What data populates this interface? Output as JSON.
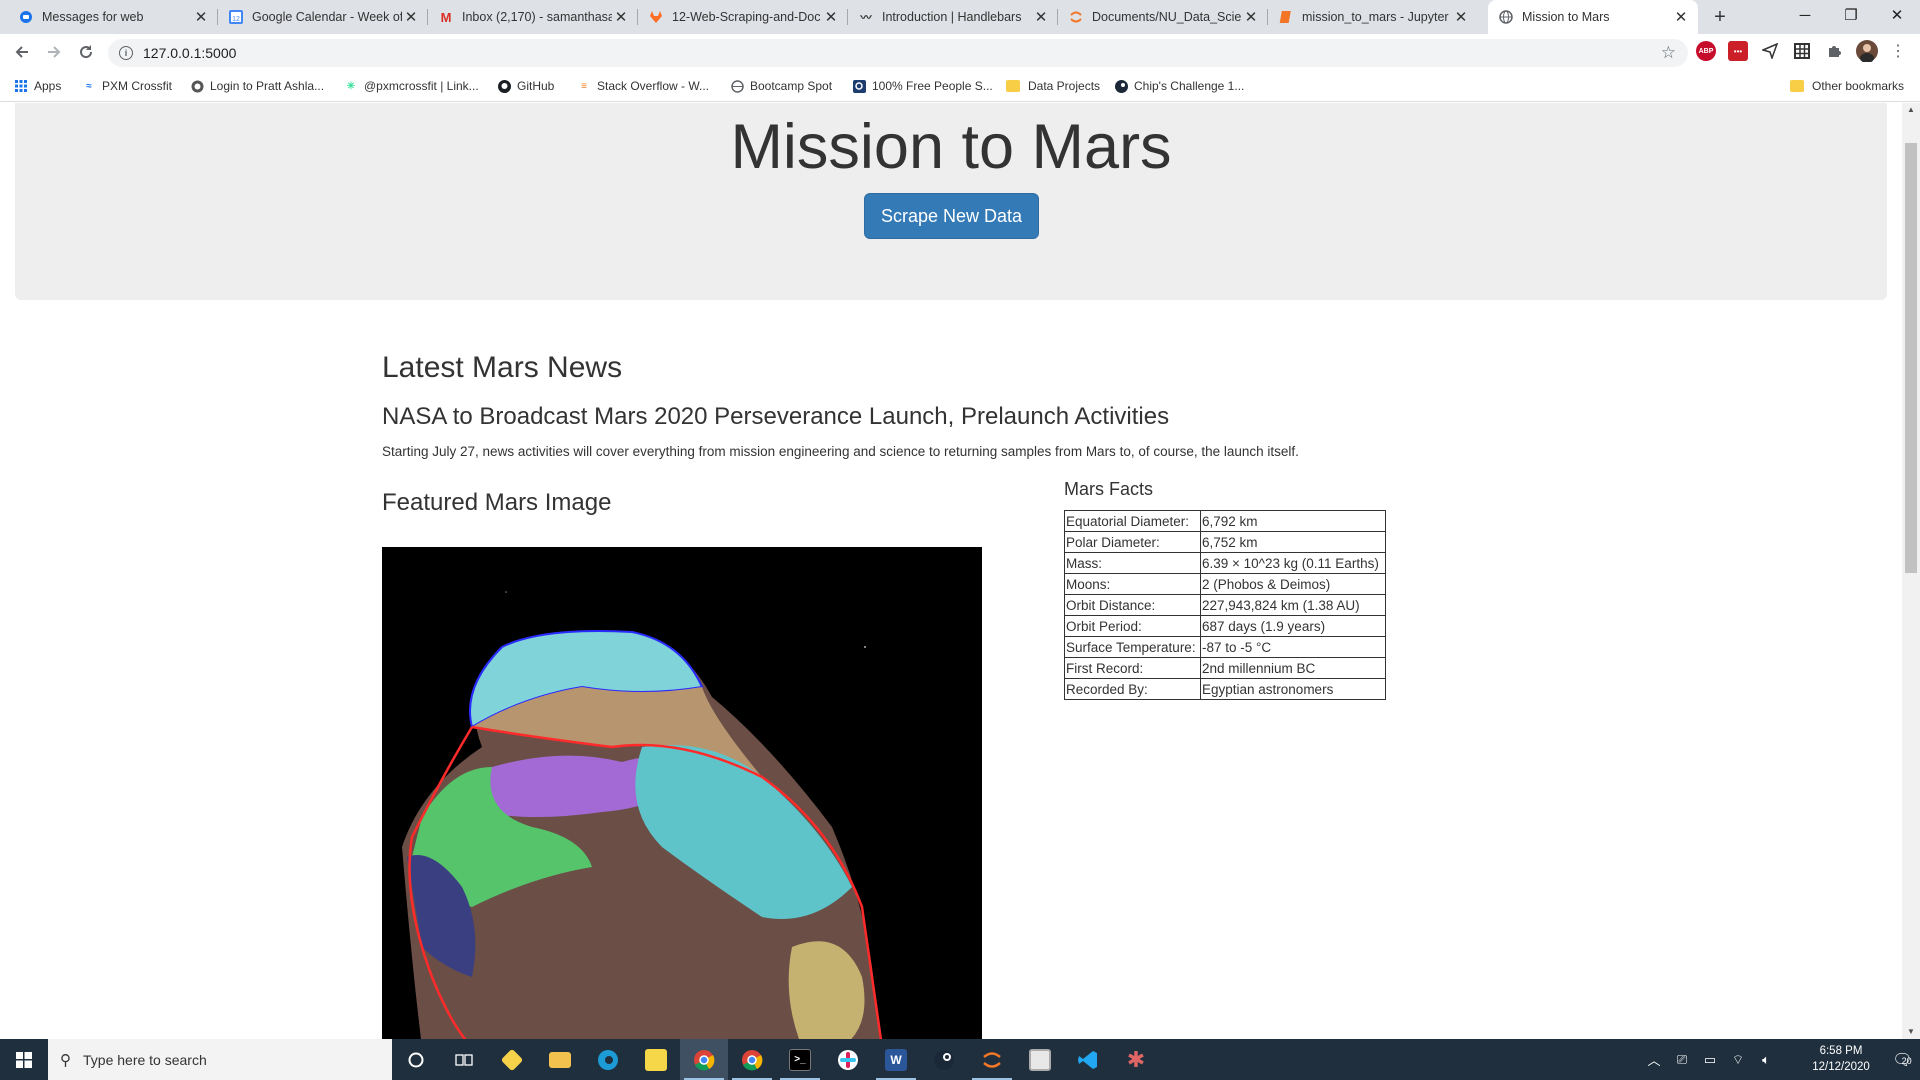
{
  "browser": {
    "tabs": [
      {
        "title": "Messages for web",
        "icon": "messages-icon",
        "color": "#1a73e8"
      },
      {
        "title": "Google Calendar - Week of",
        "icon": "calendar-icon",
        "color": "#4285f4"
      },
      {
        "title": "Inbox (2,170) - samanthasa",
        "icon": "gmail-icon",
        "color": "#d93025"
      },
      {
        "title": "12-Web-Scraping-and-Doc",
        "icon": "gitlab-icon",
        "color": "#fc6d26"
      },
      {
        "title": "Introduction | Handlebars",
        "icon": "handlebars-icon",
        "color": "#333333"
      },
      {
        "title": "Documents/NU_Data_Scien",
        "icon": "jupyter-icon",
        "color": "#f37626"
      },
      {
        "title": "mission_to_mars - Jupyter N",
        "icon": "notebook-icon",
        "color": "#f37626"
      },
      {
        "title": "Mission to Mars",
        "icon": "globe-icon",
        "color": "#5f6368"
      }
    ],
    "url": "127.0.0.1:5000",
    "bookmarks": [
      {
        "label": "Apps",
        "icon": "apps-grid-icon"
      },
      {
        "label": "PXM Crossfit",
        "icon": "pxm-icon"
      },
      {
        "label": "Login to Pratt Ashla...",
        "icon": "pratt-icon"
      },
      {
        "label": "@pxmcrossfit | Link...",
        "icon": "linktree-icon"
      },
      {
        "label": "GitHub",
        "icon": "github-icon"
      },
      {
        "label": "Stack Overflow - W...",
        "icon": "stackoverflow-icon"
      },
      {
        "label": "Bootcamp Spot",
        "icon": "globe-icon"
      },
      {
        "label": "100% Free People S...",
        "icon": "search-box-icon"
      },
      {
        "label": "Data Projects",
        "icon": "folder-icon"
      },
      {
        "label": "Chip's Challenge 1...",
        "icon": "steam-icon"
      }
    ],
    "other_bookmarks": "Other bookmarks",
    "extensions": [
      {
        "label": "ABP",
        "icon": "adblock-icon",
        "color": "#c70d2c"
      },
      {
        "label": "•••",
        "icon": "lastpass-icon",
        "color": "#cc2029"
      }
    ]
  },
  "page": {
    "title": "Mission to Mars",
    "scrape_button": "Scrape New Data",
    "news_heading": "Latest Mars News",
    "news_title": "NASA to Broadcast Mars 2020 Perseverance Launch, Prelaunch Activities",
    "news_paragraph": "Starting July 27, news activities will cover everything from mission engineering and science to returning samples from Mars to, of course, the launch itself.",
    "featured_heading": "Featured Mars Image",
    "facts_heading": "Mars Facts",
    "facts": [
      {
        "label": "Equatorial Diameter:",
        "value": "6,792 km"
      },
      {
        "label": "Polar Diameter:",
        "value": "6,752 km"
      },
      {
        "label": "Mass:",
        "value": "6.39 × 10^23 kg (0.11 Earths)"
      },
      {
        "label": "Moons:",
        "value": "2 (Phobos & Deimos)"
      },
      {
        "label": "Orbit Distance:",
        "value": "227,943,824 km (1.38 AU)"
      },
      {
        "label": "Orbit Period:",
        "value": "687 days (1.9 years)"
      },
      {
        "label": "Surface Temperature:",
        "value": "-87 to -5 °C"
      },
      {
        "label": "First Record:",
        "value": "2nd millennium BC"
      },
      {
        "label": "Recorded By:",
        "value": "Egyptian astronomers"
      }
    ]
  },
  "taskbar": {
    "search_placeholder": "Type here to search",
    "time": "6:58 PM",
    "date": "12/12/2020",
    "notification_count": "20"
  }
}
